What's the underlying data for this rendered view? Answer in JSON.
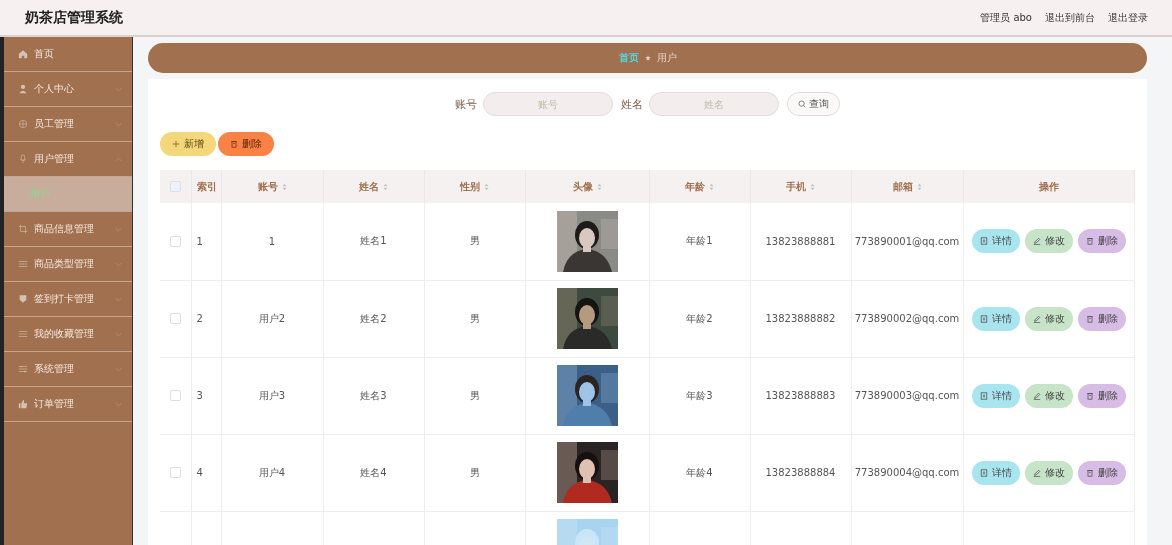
{
  "header": {
    "title": "奶茶店管理系统",
    "links": [
      "管理员 abo",
      "退出到前台",
      "退出登录"
    ]
  },
  "sidebar": {
    "items": [
      {
        "label": "首页",
        "expandable": false
      },
      {
        "label": "个人中心",
        "expandable": true,
        "expanded": false
      },
      {
        "label": "员工管理",
        "expandable": true,
        "expanded": false
      },
      {
        "label": "用户管理",
        "expandable": true,
        "expanded": true,
        "children": [
          {
            "label": "用户",
            "selected": true
          }
        ]
      },
      {
        "label": "商品信息管理",
        "expandable": true,
        "expanded": false
      },
      {
        "label": "商品类型管理",
        "expandable": true,
        "expanded": false
      },
      {
        "label": "签到打卡管理",
        "expandable": true,
        "expanded": false
      },
      {
        "label": "我的收藏管理",
        "expandable": true,
        "expanded": false
      },
      {
        "label": "系统管理",
        "expandable": true,
        "expanded": false
      },
      {
        "label": "订单管理",
        "expandable": true,
        "expanded": false
      }
    ]
  },
  "breadcrumb": [
    "首页",
    "用户"
  ],
  "search": {
    "fields": [
      {
        "label": "账号",
        "placeholder": "账号"
      },
      {
        "label": "姓名",
        "placeholder": "姓名"
      }
    ],
    "button": "查询"
  },
  "actions": [
    {
      "kind": "add",
      "label": "新增"
    },
    {
      "kind": "delete",
      "label": "删除"
    }
  ],
  "table": {
    "header_checked": false,
    "columns": [
      {
        "label": "索引",
        "sortable": false
      },
      {
        "label": "账号",
        "sortable": true
      },
      {
        "label": "姓名",
        "sortable": true
      },
      {
        "label": "性别",
        "sortable": true
      },
      {
        "label": "头像",
        "sortable": true
      },
      {
        "label": "年龄",
        "sortable": true
      },
      {
        "label": "手机",
        "sortable": true
      },
      {
        "label": "邮箱",
        "sortable": true
      },
      {
        "label": "操作",
        "sortable": false
      }
    ],
    "rows": [
      {
        "checked": false,
        "index": "1",
        "account": "1",
        "name": "姓名1",
        "gender": "男",
        "avatar": {
          "kind": "picture"
        },
        "age": "年龄1",
        "phone": "13823888881",
        "email": "773890001@qq.com",
        "actions": [
          {
            "kind": "detail",
            "label": "详情"
          },
          {
            "kind": "edit",
            "label": "修改"
          },
          {
            "kind": "delete",
            "label": "删除"
          }
        ]
      },
      {
        "checked": false,
        "index": "2",
        "account": "用户2",
        "name": "姓名2",
        "gender": "男",
        "avatar": {
          "kind": "picture"
        },
        "age": "年龄2",
        "phone": "13823888882",
        "email": "773890002@qq.com",
        "actions": [
          {
            "kind": "detail",
            "label": "详情"
          },
          {
            "kind": "edit",
            "label": "修改"
          },
          {
            "kind": "delete",
            "label": "删除"
          }
        ]
      },
      {
        "checked": false,
        "index": "3",
        "account": "用户3",
        "name": "姓名3",
        "gender": "男",
        "avatar": {
          "kind": "picture"
        },
        "age": "年龄3",
        "phone": "13823888883",
        "email": "773890003@qq.com",
        "actions": [
          {
            "kind": "detail",
            "label": "详情"
          },
          {
            "kind": "edit",
            "label": "修改"
          },
          {
            "kind": "delete",
            "label": "删除"
          }
        ]
      },
      {
        "checked": false,
        "index": "4",
        "account": "用户4",
        "name": "姓名4",
        "gender": "男",
        "avatar": {
          "kind": "picture"
        },
        "age": "年龄4",
        "phone": "13823888884",
        "email": "773890004@qq.com",
        "actions": [
          {
            "kind": "detail",
            "label": "详情"
          },
          {
            "kind": "edit",
            "label": "修改"
          },
          {
            "kind": "delete",
            "label": "删除"
          }
        ]
      },
      {
        "avatar": {
          "kind": "picture"
        }
      }
    ]
  }
}
